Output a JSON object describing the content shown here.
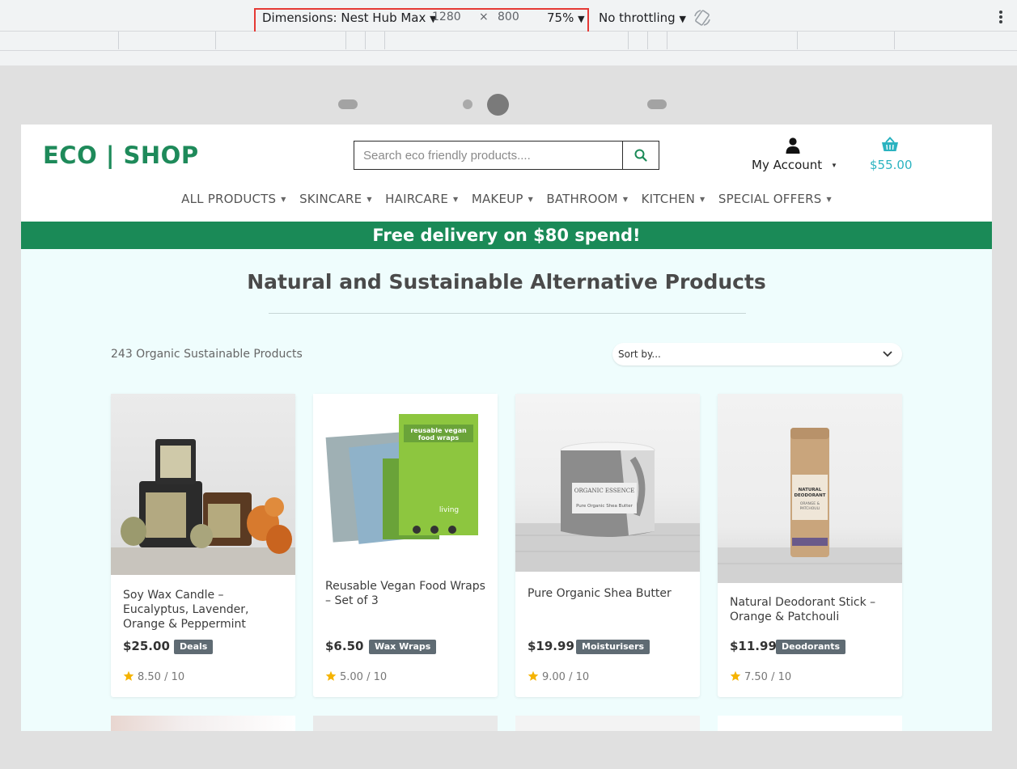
{
  "devtools": {
    "dimensions_label": "Dimensions: Nest Hub Max",
    "width": "1280",
    "times": "×",
    "height": "800",
    "zoom": "75%",
    "throttling": "No throttling",
    "arrow": "▼"
  },
  "site": {
    "logo": "ECO | SHOP",
    "search": {
      "placeholder": "Search eco friendly products...."
    },
    "account_label": "My Account",
    "cart_total": "$55.00",
    "nav": [
      "ALL PRODUCTS",
      "SKINCARE",
      "HAIRCARE",
      "MAKEUP",
      "BATHROOM",
      "KITCHEN",
      "SPECIAL OFFERS"
    ],
    "banner": "Free delivery on $80 spend!",
    "colors": {
      "brand_green": "#1a8a57",
      "cart_teal": "#2bb3c0",
      "page_bg": "#effdfd",
      "badge_gray": "#5f6b73",
      "star": "#f5b301"
    }
  },
  "listing": {
    "title": "Natural and Sustainable Alternative Products",
    "count_label": "243 Organic Sustainable Products",
    "sort_value": "Sort by...",
    "products": [
      {
        "name": "Soy Wax Candle – Eucalyptus, Lavender, Orange & Peppermint",
        "price": "$25.00",
        "category": "Deals",
        "rating": "8.50 / 10"
      },
      {
        "name": "Reusable Vegan Food Wraps – Set of 3",
        "price": "$6.50",
        "category": "Wax Wraps",
        "rating": "5.00 / 10"
      },
      {
        "name": "Pure Organic Shea Butter",
        "price": "$19.99",
        "category": "Moisturisers",
        "rating": "9.00 / 10"
      },
      {
        "name": "Natural Deodorant Stick – Orange & Patchouli",
        "price": "$11.99",
        "category": "Deodorants",
        "rating": "7.50 / 10"
      }
    ],
    "product_image_text": {
      "wraps_packet": "reusable vegan food wraps",
      "wraps_brand": "living",
      "shea_brand": "ORGANIC ESSENCE",
      "shea_label": "Pure Organic Shea Butter",
      "deo_label": "NATURAL DEODORANT",
      "deo_scent": "ORANGE & PATCHOULI"
    }
  }
}
